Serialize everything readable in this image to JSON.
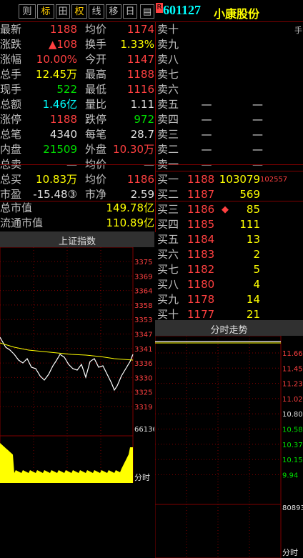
{
  "tabs": [
    "则",
    "标",
    "田",
    "权",
    "线",
    "移",
    "日",
    "R"
  ],
  "stock": {
    "code": "601127",
    "name": "小康股份"
  },
  "quote_left": [
    {
      "label": "最新",
      "value": "1188",
      "color": "red"
    },
    {
      "label": "涨跌",
      "value": "▲108",
      "color": "red"
    },
    {
      "label": "涨幅",
      "value": "10.00%",
      "color": "red"
    },
    {
      "label": "总手",
      "value": "12.45万",
      "color": "yellow"
    },
    {
      "label": "现手",
      "value": "522",
      "color": "green"
    },
    {
      "label": "总额",
      "value": "1.46亿",
      "color": "cyan"
    },
    {
      "label": "涨停",
      "value": "1188",
      "color": "red"
    },
    {
      "label": "总笔",
      "value": "4340",
      "color": "white"
    },
    {
      "label": "内盘",
      "value": "21509",
      "color": "green"
    },
    {
      "label": "总卖",
      "value": "—",
      "color": "white"
    },
    {
      "label": "总买",
      "value": "10.83万",
      "color": "yellow"
    },
    {
      "label": "市盈",
      "value": "-15.48③",
      "color": "white"
    }
  ],
  "quote_right": [
    {
      "label": "均价",
      "value": "1174",
      "color": "red"
    },
    {
      "label": "换手",
      "value": "1.33%",
      "color": "yellow"
    },
    {
      "label": "今开",
      "value": "1147",
      "color": "red"
    },
    {
      "label": "最高",
      "value": "1188",
      "color": "red"
    },
    {
      "label": "最低",
      "value": "1116",
      "color": "red"
    },
    {
      "label": "量比",
      "value": "1.11",
      "color": "white"
    },
    {
      "label": "跌停",
      "value": "972",
      "color": "green"
    },
    {
      "label": "每笔",
      "value": "28.7",
      "color": "white"
    },
    {
      "label": "外盘",
      "value": "10.30万",
      "color": "red"
    },
    {
      "label": "均价",
      "value": "—",
      "color": "white"
    },
    {
      "label": "均价",
      "value": "1186",
      "color": "red"
    },
    {
      "label": "市净",
      "value": "2.59",
      "color": "white"
    }
  ],
  "market_cap": {
    "label": "总市值",
    "value": "149.78亿"
  },
  "float_cap": {
    "label": "流通市值",
    "value": "110.89亿"
  },
  "sell_levels": [
    {
      "label": "卖十",
      "price": "",
      "vol": ""
    },
    {
      "label": "卖九",
      "price": "",
      "vol": ""
    },
    {
      "label": "卖八",
      "price": "",
      "vol": ""
    },
    {
      "label": "卖七",
      "price": "",
      "vol": ""
    },
    {
      "label": "卖六",
      "price": "",
      "vol": ""
    },
    {
      "label": "卖五",
      "price": "—",
      "vol": "—"
    },
    {
      "label": "卖四",
      "price": "—",
      "vol": "—"
    },
    {
      "label": "卖三",
      "price": "—",
      "vol": "—"
    },
    {
      "label": "卖二",
      "price": "—",
      "vol": "—"
    },
    {
      "label": "卖一",
      "price": "—",
      "vol": "—"
    }
  ],
  "buy_levels": [
    {
      "label": "买一",
      "price": "1188",
      "vol": "103079",
      "extra": "102557"
    },
    {
      "label": "买二",
      "price": "1187",
      "vol": "569",
      "extra": ""
    },
    {
      "label": "买三",
      "price": "1186",
      "vol": "85",
      "extra": "◆"
    },
    {
      "label": "买四",
      "price": "1185",
      "vol": "111",
      "extra": ""
    },
    {
      "label": "买五",
      "price": "1184",
      "vol": "13",
      "extra": ""
    },
    {
      "label": "买六",
      "price": "1183",
      "vol": "2",
      "extra": ""
    },
    {
      "label": "买七",
      "price": "1182",
      "vol": "5",
      "extra": ""
    },
    {
      "label": "买八",
      "price": "1180",
      "vol": "4",
      "extra": ""
    },
    {
      "label": "买九",
      "price": "1178",
      "vol": "14",
      "extra": ""
    },
    {
      "label": "买十",
      "price": "1177",
      "vol": "21",
      "extra": ""
    }
  ],
  "hand_label": "手",
  "index_chart": {
    "title": "上证指数",
    "yticks": [
      "3375",
      "3369",
      "3364",
      "3358",
      "3353",
      "3347",
      "3341",
      "3336",
      "3330",
      "3325",
      "3319"
    ],
    "vol_top": "66136",
    "xlabel": "分时"
  },
  "intraday_chart": {
    "title": "分时走势",
    "yticks": [
      "11.66",
      "11.45",
      "11.23",
      "11.02",
      "10.80",
      "10.58",
      "10.37",
      "10.15",
      "9.94"
    ],
    "vol_top": "80893",
    "xlabel": "分时"
  }
}
